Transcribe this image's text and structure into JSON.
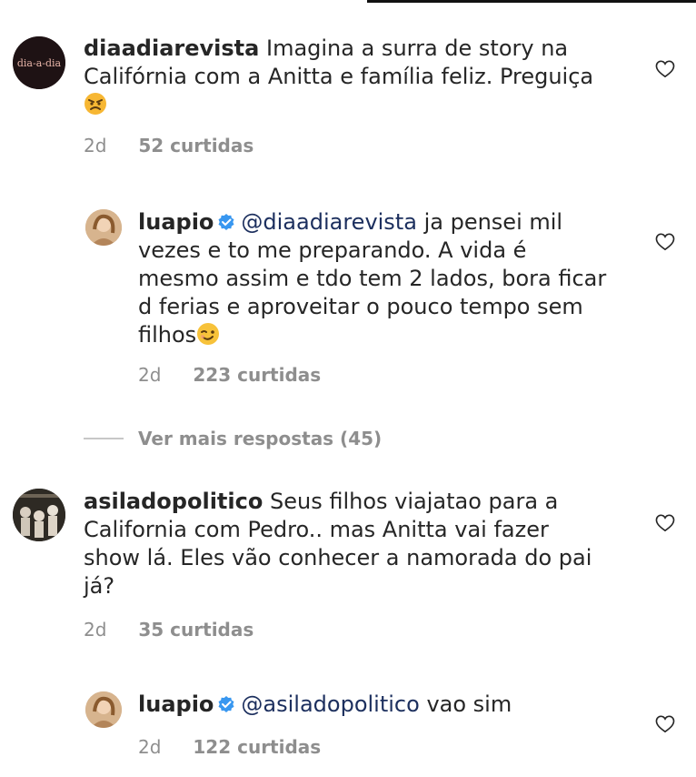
{
  "comments": [
    {
      "username": "diaadiarevista",
      "text": "Imagina a surra de story na Califórnia com a Anitta e família feliz. Preguiça",
      "emoji": "angry-face",
      "time": "2d",
      "likes": "52 curtidas",
      "avatar_text": "dia-a-dia"
    },
    {
      "username": "luapio",
      "verified": true,
      "mention": "@diaadiarevista",
      "text": "ja pensei mil vezes e to me preparando. A vida é mesmo assim e tdo tem 2 lados, bora ficar d ferias e aproveitar o pouco tempo sem filhos",
      "emoji": "winking-face",
      "time": "2d",
      "likes": "223 curtidas"
    },
    {
      "username": "asiladopolitico",
      "text": "Seus filhos viajatao para a California com Pedro.. mas Anitta vai fazer show lá. Eles vão  conhecer a namorada do pai já?",
      "time": "2d",
      "likes": "35 curtidas"
    },
    {
      "username": "luapio",
      "verified": true,
      "mention": "@asiladopolitico",
      "text": "vao sim",
      "time": "2d",
      "likes": "122 curtidas"
    }
  ],
  "view_more": "Ver mais respostas (45)",
  "colors": {
    "text": "#262626",
    "meta": "#8e8e8e",
    "mention": "#1c2f5e",
    "verified": "#3897f0"
  },
  "icons": {
    "like": "heart-icon",
    "verified": "verified-badge-icon"
  }
}
